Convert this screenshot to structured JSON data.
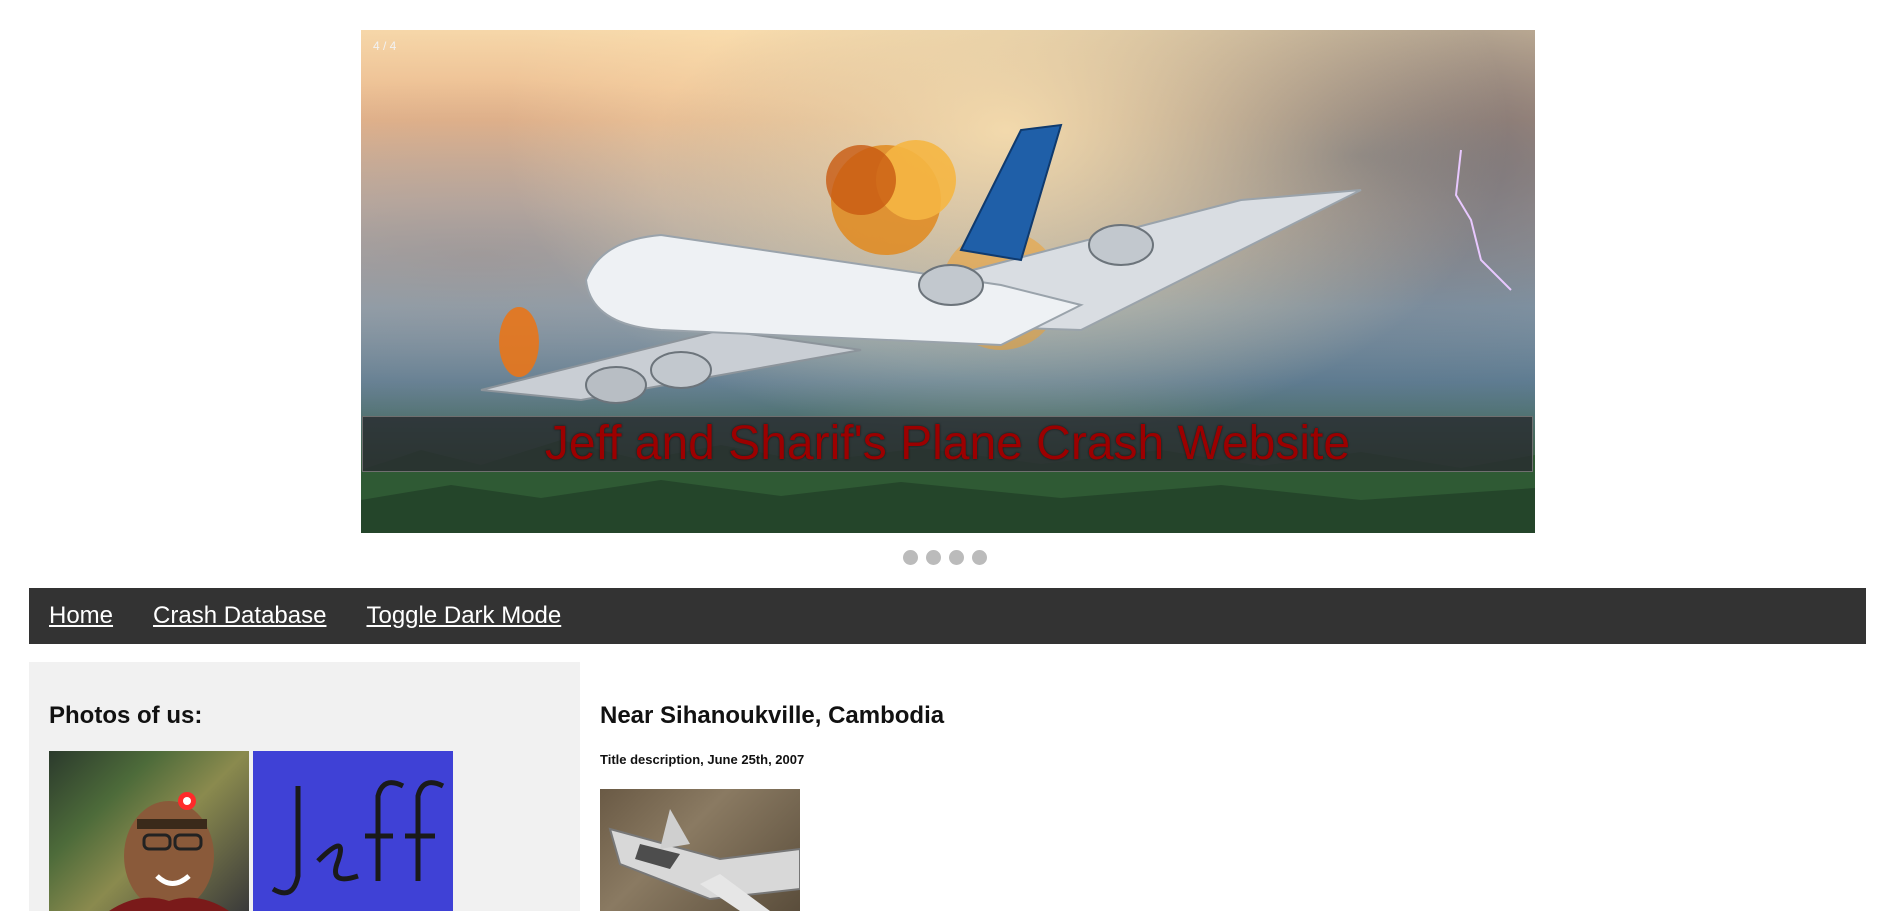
{
  "slideshow": {
    "counter": "4 / 4",
    "caption": "Jeff and Sharif's Plane Crash Website",
    "dot_count": 4,
    "current_slide": 4,
    "total_slides": 4
  },
  "nav": {
    "items": [
      {
        "label": "Home"
      },
      {
        "label": "Crash Database"
      },
      {
        "label": "Toggle Dark Mode"
      }
    ]
  },
  "sidebar": {
    "title": "Photos of us:"
  },
  "main": {
    "article_title": "Near Sihanoukville, Cambodia",
    "article_description": "Title description, June 25th, 2007"
  },
  "colors": {
    "navbar_bg": "#333333",
    "caption_text": "#9c0000",
    "sidebar_bg": "#f1f1f1",
    "dot": "#bbbbbb"
  }
}
